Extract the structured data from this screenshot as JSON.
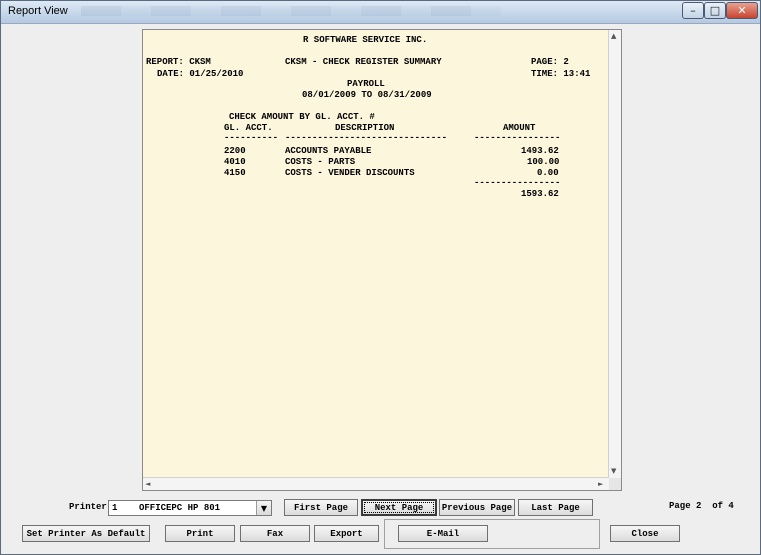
{
  "window": {
    "title": "Report View",
    "controls": {
      "minimize": "–",
      "maximize": "□",
      "close": "✕"
    }
  },
  "report": {
    "company": "R SOFTWARE SERVICE INC.",
    "report_label": "REPORT: CKSM",
    "report_title": "CKSM - CHECK REGISTER SUMMARY",
    "page_label": "PAGE: 2",
    "date_label": "DATE: 01/25/2010",
    "time_label": "TIME: 13:41",
    "section": "PAYROLL",
    "period": "08/01/2009 TO 08/31/2009",
    "subtitle": "CHECK AMOUNT BY GL. ACCT. #",
    "columns": [
      "GL. ACCT.",
      "DESCRIPTION",
      "AMOUNT"
    ],
    "rule_acct": "----------",
    "rule_desc": "------------------------------",
    "rule_amount": "----------------",
    "rows": [
      {
        "acct": "2200",
        "desc": "ACCOUNTS PAYABLE",
        "amount": "1493.62"
      },
      {
        "acct": "4010",
        "desc": "COSTS - PARTS",
        "amount": "100.00"
      },
      {
        "acct": "4150",
        "desc": "COSTS - VENDER DISCOUNTS",
        "amount": "0.00"
      }
    ],
    "total_rule": "----------------",
    "total": "1593.62"
  },
  "scroll": {
    "up": "▲",
    "down": "▼",
    "left": "◄",
    "right": "►"
  },
  "controls": {
    "printer_label": "Printer",
    "printer_value": "1    OFFICEPC HP 801",
    "dropdown_arrow": "▼",
    "first_page": "First Page",
    "next_page": "Next Page",
    "previous_page": "Previous Page",
    "last_page": "Last Page",
    "page_status": "Page 2  of 4",
    "set_default": "Set Printer As Default",
    "print": "Print",
    "fax": "Fax",
    "export": "Export",
    "email": "E-Mail",
    "close": "Close"
  }
}
